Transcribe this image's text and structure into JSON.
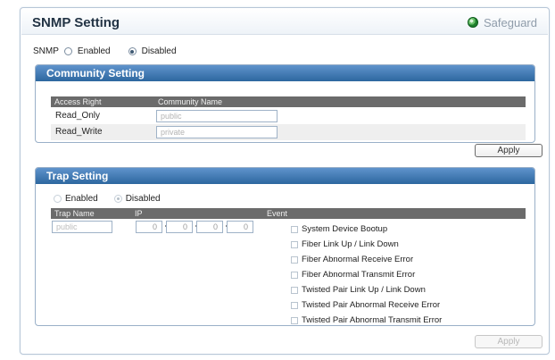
{
  "page": {
    "title": "SNMP Setting",
    "safeguard_label": "Safeguard",
    "colors": {
      "header_blue": "#2d679f",
      "table_header": "#6b6b6b",
      "safeguard_green": "#1f7f2d"
    }
  },
  "snmp": {
    "label": "SNMP",
    "options": [
      "Enabled",
      "Disabled"
    ],
    "selected": "Disabled"
  },
  "community": {
    "section_title": "Community Setting",
    "columns": [
      "Access Right",
      "Community Name"
    ],
    "rows": [
      {
        "access": "Read_Only",
        "name": "public"
      },
      {
        "access": "Read_Write",
        "name": "private"
      }
    ],
    "apply_label": "Apply"
  },
  "trap": {
    "section_title": "Trap Setting",
    "options": [
      "Enabled",
      "Disabled"
    ],
    "selected": "Disabled",
    "columns": [
      "Trap Name",
      "IP",
      "Event"
    ],
    "trap_name": "public",
    "ip": [
      "0",
      "0",
      "0",
      "0"
    ],
    "events": [
      "System Device Bootup",
      "Fiber Link Up / Link Down",
      "Fiber Abnormal Receive Error",
      "Fiber Abnormal Transmit Error",
      "Twisted Pair Link Up / Link Down",
      "Twisted Pair Abnormal Receive Error",
      "Twisted Pair Abnormal Transmit Error"
    ],
    "apply_label": "Apply"
  }
}
